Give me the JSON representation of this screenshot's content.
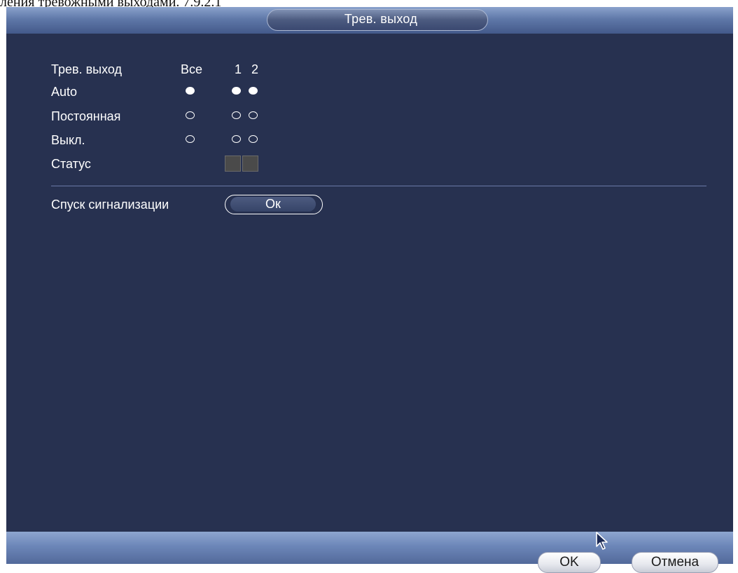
{
  "caption_text": "ления тревожными выходами. 7.9.2.1",
  "window": {
    "title": "Трев. выход"
  },
  "grid": {
    "header_label": "Трев. выход",
    "column_all": "Все",
    "column_1": "1",
    "column_2": "2",
    "rows": [
      {
        "label": "Auto",
        "all": true,
        "ch1": true,
        "ch2": true
      },
      {
        "label": "Постоянная",
        "all": false,
        "ch1": false,
        "ch2": false
      },
      {
        "label": "Выкл.",
        "all": false,
        "ch1": false,
        "ch2": false
      }
    ],
    "status_label": "Статус"
  },
  "alarm_release": {
    "label": "Спуск сигнализации",
    "button_label": "Ок"
  },
  "footer": {
    "ok_label": "OK",
    "cancel_label": "Отмена"
  },
  "colors": {
    "panel_bg": "#273150",
    "bar_accent": "#6c86b8",
    "status_idle": "#4a4a4a"
  }
}
